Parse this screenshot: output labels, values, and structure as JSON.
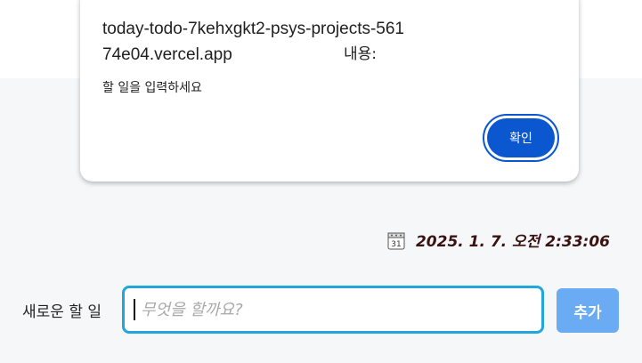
{
  "dialog": {
    "title": "today-todo-7kehxgkt2-psys-projects-56174e04.vercel.app",
    "title_suffix": "내용:",
    "message": "할 일을 입력하세요",
    "ok_label": "확인"
  },
  "datetime": {
    "icon": "calendar-icon",
    "calendar_day": "31",
    "text": "2025. 1. 7. 오전 2:33:06"
  },
  "todo_form": {
    "label": "새로운 할 일",
    "input_value": "",
    "input_placeholder": "무엇을 할까요?",
    "add_label": "추가"
  },
  "colors": {
    "dialog_button": "#0b57d0",
    "input_border": "#22a7dc",
    "add_button": "#6aabf3",
    "datetime_text": "#3a1212"
  }
}
